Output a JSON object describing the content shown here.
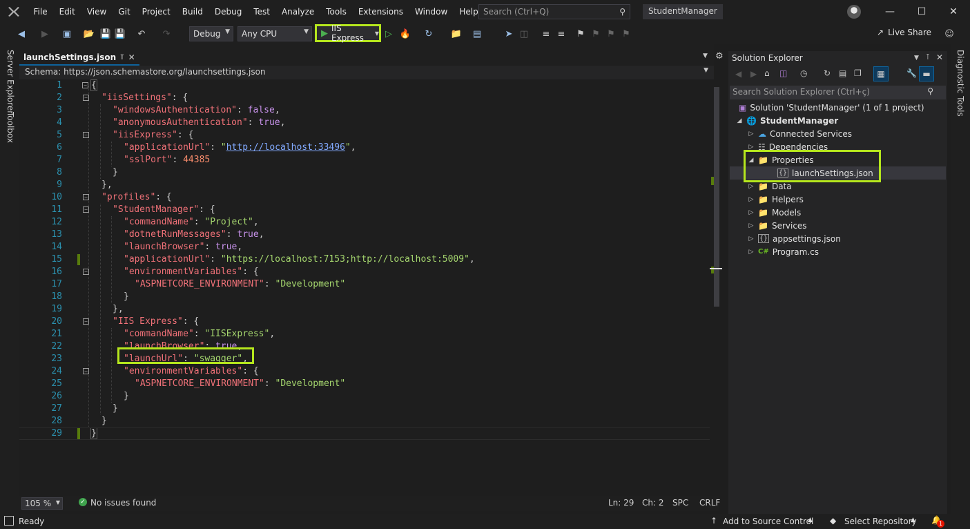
{
  "menu": [
    "File",
    "Edit",
    "View",
    "Git",
    "Project",
    "Build",
    "Debug",
    "Test",
    "Analyze",
    "Tools",
    "Extensions",
    "Window",
    "Help"
  ],
  "search": {
    "placeholder": "Search (Ctrl+Q)"
  },
  "project_title": "StudentManager",
  "toolbar": {
    "config": "Debug",
    "platform": "Any CPU",
    "run_label": "IIS Express",
    "live_share": "Live Share"
  },
  "left_strip": {
    "server_explorer": "Server Explorer",
    "toolbox": "Toolbox"
  },
  "right_strip": {
    "diagnostic_tools": "Diagnostic Tools"
  },
  "editor": {
    "tab_label": "launchSettings.json",
    "schema_label": "Schema:",
    "schema_url": "https://json.schemastore.org/launchsettings.json",
    "lines": [
      {
        "n": "1",
        "text": "{"
      },
      {
        "n": "2",
        "text": "\"iisSettings\": {"
      },
      {
        "n": "3",
        "text": "\"windowsAuthentication\": false,"
      },
      {
        "n": "4",
        "text": "\"anonymousAuthentication\": true,"
      },
      {
        "n": "5",
        "text": "\"iisExpress\": {"
      },
      {
        "n": "6",
        "text": "\"applicationUrl\": \"http://localhost:33496\","
      },
      {
        "n": "7",
        "text": "\"sslPort\": 44385"
      },
      {
        "n": "8",
        "text": "}"
      },
      {
        "n": "9",
        "text": "},"
      },
      {
        "n": "10",
        "text": "\"profiles\": {"
      },
      {
        "n": "11",
        "text": "\"StudentManager\": {"
      },
      {
        "n": "12",
        "text": "\"commandName\": \"Project\","
      },
      {
        "n": "13",
        "text": "\"dotnetRunMessages\": true,"
      },
      {
        "n": "14",
        "text": "\"launchBrowser\": true,"
      },
      {
        "n": "15",
        "text": "\"applicationUrl\": \"https://localhost:7153;http://localhost:5009\","
      },
      {
        "n": "16",
        "text": "\"environmentVariables\": {"
      },
      {
        "n": "17",
        "text": "\"ASPNETCORE_ENVIRONMENT\": \"Development\""
      },
      {
        "n": "18",
        "text": "}"
      },
      {
        "n": "19",
        "text": "},"
      },
      {
        "n": "20",
        "text": "\"IIS Express\": {"
      },
      {
        "n": "21",
        "text": "\"commandName\": \"IISExpress\","
      },
      {
        "n": "22",
        "text": "\"launchBrowser\": true,"
      },
      {
        "n": "23",
        "text": "\"launchUrl\": \"swagger\","
      },
      {
        "n": "24",
        "text": "\"environmentVariables\": {"
      },
      {
        "n": "25",
        "text": "\"ASPNETCORE_ENVIRONMENT\": \"Development\""
      },
      {
        "n": "26",
        "text": "}"
      },
      {
        "n": "27",
        "text": "}"
      },
      {
        "n": "28",
        "text": "}"
      },
      {
        "n": "29",
        "text": "}"
      }
    ],
    "status": {
      "zoom": "105 %",
      "issues": "No issues found",
      "ln": "Ln: 29",
      "ch": "Ch: 2",
      "spc": "SPC",
      "crlf": "CRLF"
    }
  },
  "solution_explorer": {
    "title": "Solution Explorer",
    "search_placeholder": "Search Solution Explorer (Ctrl+ç)",
    "solution": "Solution 'StudentManager' (1 of 1 project)",
    "project": "StudentManager",
    "items": {
      "connected": "Connected Services",
      "dependencies": "Dependencies",
      "properties": "Properties",
      "launch": "launchSettings.json",
      "data": "Data",
      "helpers": "Helpers",
      "models": "Models",
      "services": "Services",
      "appsettings": "appsettings.json",
      "program": "Program.cs"
    },
    "csharp_glyph": "C#"
  },
  "statusbar": {
    "ready": "Ready",
    "add_source": "Add to Source Control",
    "select_repo": "Select Repository",
    "notif_count": "1"
  },
  "colors": {
    "highlight": "#b5e61d",
    "accent": "#0e639c"
  }
}
